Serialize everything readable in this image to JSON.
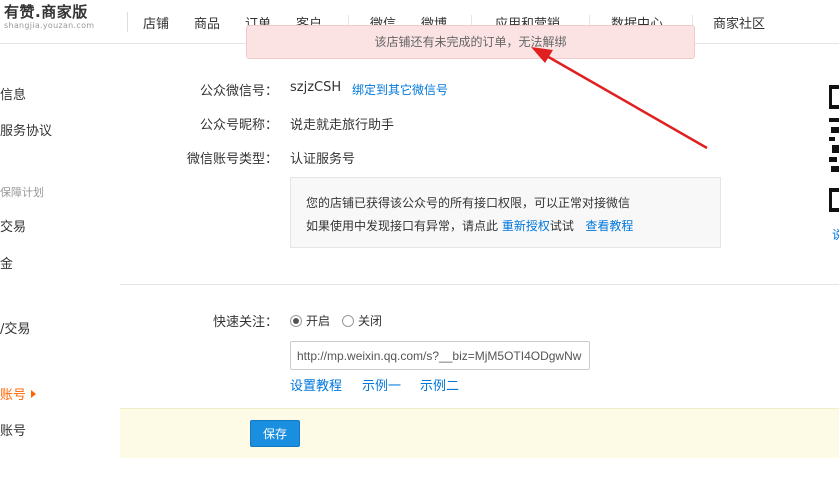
{
  "header": {
    "logo_title": "有赞.商家版",
    "logo_domain": "shangjia.youzan.com",
    "nav": [
      "店铺",
      "商品",
      "订单",
      "客户",
      "微信",
      "微博",
      "应用和营销",
      "数据中心",
      "商家社区"
    ]
  },
  "toast": {
    "message": "该店铺还有未完成的订单，无法解绑"
  },
  "sidebar": {
    "items": [
      {
        "label": "信息"
      },
      {
        "label": "服务协议"
      },
      {
        "label": "保障计划",
        "group": true
      },
      {
        "label": "交易"
      },
      {
        "label": "金"
      },
      {
        "label": "/交易"
      },
      {
        "label": "账号",
        "active": true
      },
      {
        "label": "账号"
      }
    ]
  },
  "form": {
    "public_account_label": "公众微信号：",
    "public_account_value": "szjzCSH",
    "rebind_link": "绑定到其它微信号",
    "nickname_label": "公众号昵称：",
    "nickname_value": "说走就走旅行助手",
    "type_label": "微信账号类型：",
    "type_value": "认证服务号",
    "notice_line1": "您的店铺已获得该公众号的所有接口权限，可以正常对接微信",
    "notice_line2_prefix": "如果使用中发现接口有异常，请点此",
    "reauth_link": "重新授权",
    "notice_line2_suffix": "试试",
    "tutorial_link": "查看教程",
    "quick_follow_label": "快速关注：",
    "radio_on": "开启",
    "radio_off": "关闭",
    "radio_selected": "开启",
    "url_value": "http://mp.weixin.qq.com/s?__biz=MjM5OTI4ODgwNw",
    "setup_tutorial": "设置教程",
    "example1": "示例一",
    "example2": "示例二",
    "save_label": "保存"
  },
  "qr_caption": "说",
  "colors": {
    "link": "#0077dd",
    "active": "#ff6600",
    "toast_bg": "#fbe3e4",
    "arrow": "#e02020",
    "save": "#1a8fe0"
  }
}
